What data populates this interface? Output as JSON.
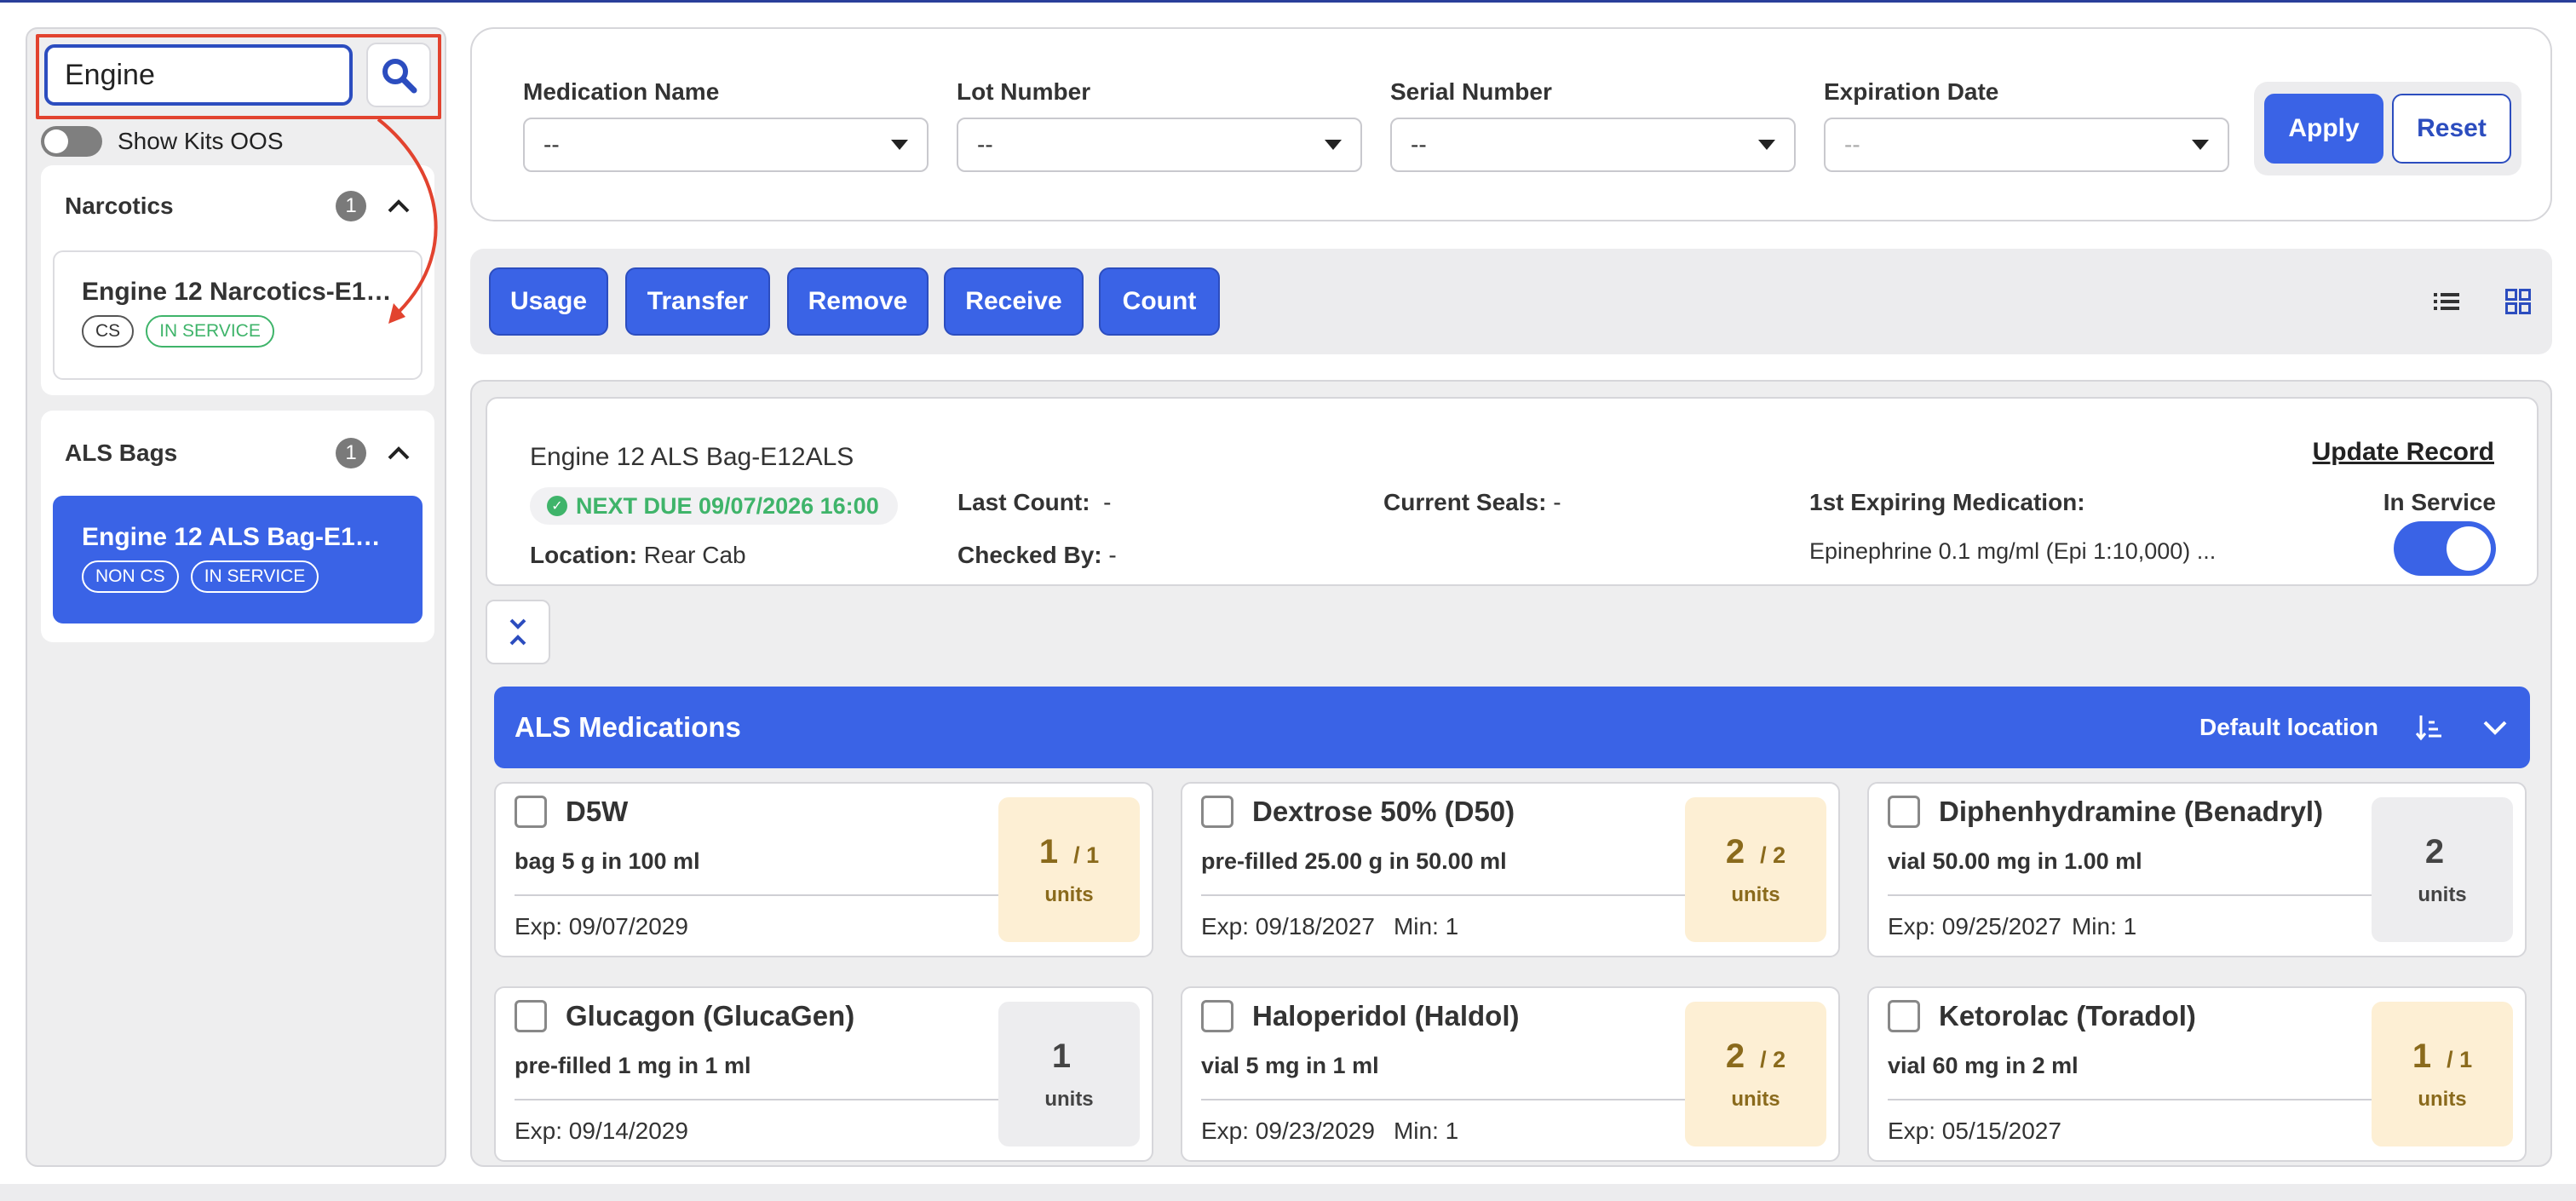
{
  "sidebar": {
    "search": {
      "value": "Engine"
    },
    "show_kits_oos_label": "Show Kits OOS",
    "groups": [
      {
        "title": "Narcotics",
        "count": "1",
        "kits": [
          {
            "name": "Engine 12 Narcotics-E12...",
            "tags": [
              "CS",
              "IN SERVICE"
            ]
          }
        ]
      },
      {
        "title": "ALS Bags",
        "count": "1",
        "kits": [
          {
            "name": "Engine 12 ALS Bag-E12ALS",
            "tags": [
              "NON CS",
              "IN SERVICE"
            ]
          }
        ]
      }
    ]
  },
  "filters": {
    "medication_name": {
      "label": "Medication Name",
      "value": "--"
    },
    "lot_number": {
      "label": "Lot Number",
      "value": "--"
    },
    "serial_number": {
      "label": "Serial Number",
      "value": "--"
    },
    "expiration_date": {
      "label": "Expiration Date",
      "value": "--"
    },
    "apply_label": "Apply",
    "reset_label": "Reset"
  },
  "actions": {
    "usage": "Usage",
    "transfer": "Transfer",
    "remove": "Remove",
    "receive": "Receive",
    "count": "Count",
    "list_view_icon": "list-icon",
    "grid_view_icon": "grid-icon"
  },
  "kit": {
    "title": "Engine 12 ALS Bag-E12ALS",
    "next_due": "NEXT DUE 09/07/2026 16:00",
    "location_label": "Location:",
    "location_value": "Rear Cab",
    "last_count_label": "Last Count:",
    "last_count_value": "-",
    "checked_by_label": "Checked By:",
    "checked_by_value": "-",
    "current_seals_label": "Current Seals:",
    "current_seals_value": "-",
    "first_expiring_label": "1st Expiring Medication:",
    "first_expiring_value": "Epinephrine 0.1 mg/ml (Epi 1:10,000) ...",
    "update_record": "Update Record",
    "in_service_label": "In Service",
    "in_service": true
  },
  "section": {
    "title": "ALS Medications",
    "location": "Default location"
  },
  "medications": [
    {
      "name": "D5W",
      "desc": "bag 5 g in 100 ml",
      "exp": "Exp: 09/07/2029",
      "min": "",
      "qty": "1",
      "of": "/ 1",
      "unit": "units",
      "status": "warn"
    },
    {
      "name": "Dextrose 50% (D50)",
      "desc": "pre-filled 25.00 g in 50.00 ml",
      "exp": "Exp: 09/18/2027",
      "min": "Min: 1",
      "qty": "2",
      "of": "/ 2",
      "unit": "units",
      "status": "warn"
    },
    {
      "name": "Diphenhydramine (Benadryl)",
      "desc": "vial 50.00 mg in 1.00 ml",
      "exp": "Exp: 09/25/2027",
      "min": "Min: 1",
      "qty": "2",
      "of": "",
      "unit": "units",
      "status": "ok"
    },
    {
      "name": "Glucagon (GlucaGen)",
      "desc": "pre-filled 1 mg in 1 ml",
      "exp": "Exp: 09/14/2029",
      "min": "",
      "qty": "1",
      "of": "",
      "unit": "units",
      "status": "ok"
    },
    {
      "name": "Haloperidol (Haldol)",
      "desc": "vial 5 mg in 1 ml",
      "exp": "Exp: 09/23/2029",
      "min": "Min: 1",
      "qty": "2",
      "of": "/ 2",
      "unit": "units",
      "status": "warn"
    },
    {
      "name": "Ketorolac (Toradol)",
      "desc": "vial 60 mg in 2 ml",
      "exp": "Exp: 05/15/2027",
      "min": "",
      "qty": "1",
      "of": "/ 1",
      "unit": "units",
      "status": "warn"
    }
  ],
  "colors": {
    "primary": "#3a63e6",
    "success": "#3fb46a",
    "warning_bg": "#fdefd4",
    "annotation": "#e2432f"
  }
}
